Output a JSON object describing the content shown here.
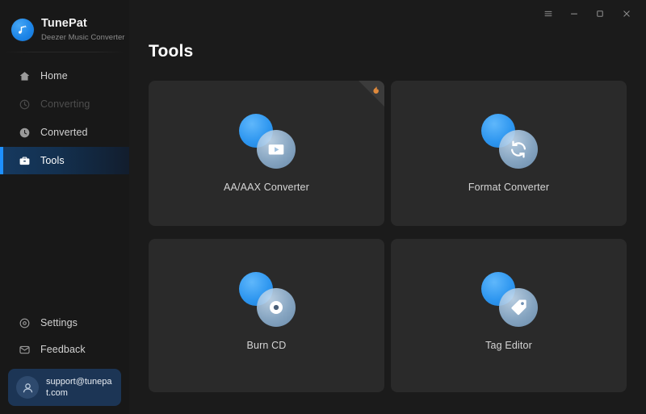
{
  "app": {
    "brand_title": "TunePat",
    "brand_subtitle": "Deezer Music Converter",
    "logo_icon": "music-note-icon",
    "accent_color": "#1e90ff",
    "sidebar_bg": "#181818",
    "main_bg": "#1b1b1b",
    "card_bg": "#2a2a2a"
  },
  "titlebar": {
    "buttons": [
      {
        "name": "menu-button",
        "icon": "hamburger-menu-icon",
        "label": "Menu"
      },
      {
        "name": "minimize-button",
        "icon": "minimize-icon",
        "label": "Minimize"
      },
      {
        "name": "maximize-button",
        "icon": "maximize-icon",
        "label": "Maximize"
      },
      {
        "name": "close-button",
        "icon": "close-icon",
        "label": "Close"
      }
    ]
  },
  "sidebar": {
    "items": [
      {
        "label": "Home",
        "icon": "home-icon",
        "state": "normal"
      },
      {
        "label": "Converting",
        "icon": "converting-icon",
        "state": "disabled"
      },
      {
        "label": "Converted",
        "icon": "clock-icon",
        "state": "normal"
      },
      {
        "label": "Tools",
        "icon": "toolbox-icon",
        "state": "active"
      }
    ],
    "bottom_items": [
      {
        "label": "Settings",
        "icon": "gear-icon"
      },
      {
        "label": "Feedback",
        "icon": "message-icon"
      }
    ],
    "account": {
      "email": "support@tunepat.com",
      "avatar_icon": "user-avatar-icon"
    }
  },
  "main": {
    "page_title": "Tools",
    "cards": [
      {
        "label": "AA/AAX Converter",
        "icon": "play-video-icon",
        "badge": "flame-corner-badge",
        "has_badge": true
      },
      {
        "label": "Format Converter",
        "icon": "refresh-sync-icon",
        "has_badge": false
      },
      {
        "label": "Burn CD",
        "icon": "cd-disc-icon",
        "has_badge": false
      },
      {
        "label": "Tag Editor",
        "icon": "price-tag-icon",
        "has_badge": false
      }
    ]
  }
}
